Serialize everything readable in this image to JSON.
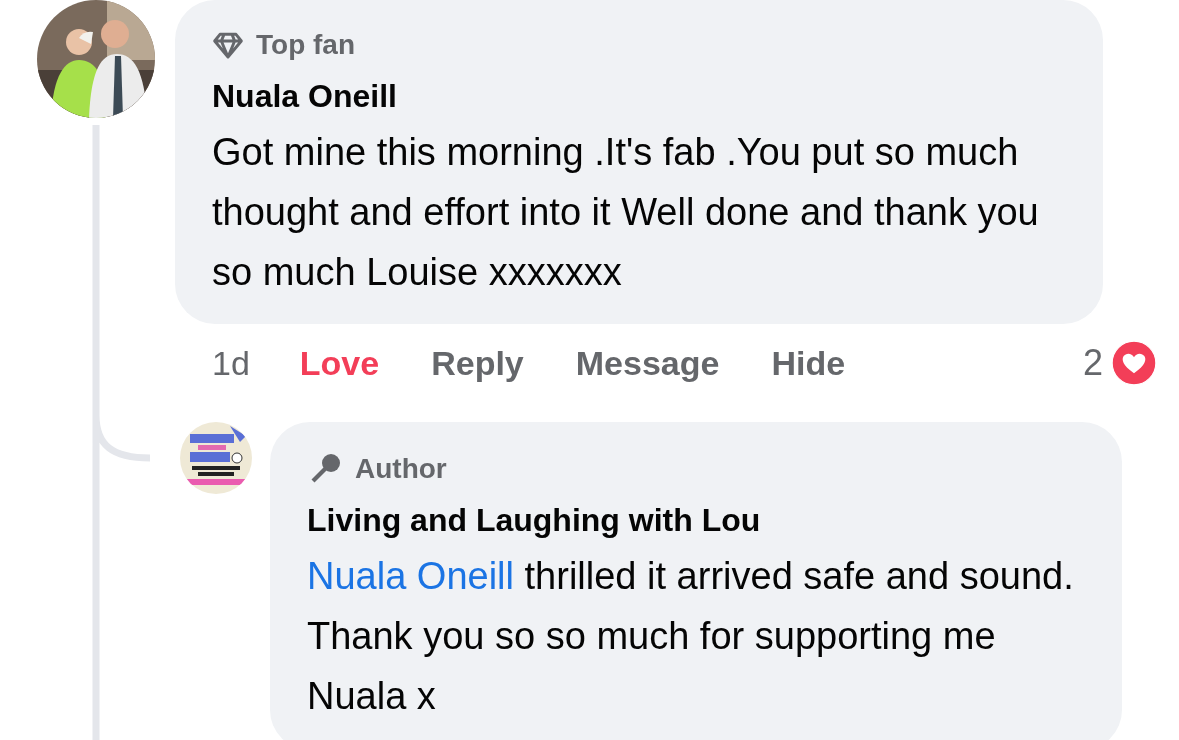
{
  "comment": {
    "badge": "Top fan",
    "author": "Nuala Oneill",
    "text": "Got mine this morning .It's fab .You put so much thought and effort into it Well done and thank you so much Louise xxxxxxx"
  },
  "actions": {
    "time": "1d",
    "items": [
      {
        "label": "Love",
        "selected": true
      },
      {
        "label": "Reply",
        "selected": false
      },
      {
        "label": "Message",
        "selected": false
      },
      {
        "label": "Hide",
        "selected": false
      }
    ],
    "reaction_count": "2"
  },
  "reply": {
    "badge": "Author",
    "author": "Living and Laughing with Lou",
    "mention": "Nuala Oneill",
    "text": " thrilled it arrived safe and sound. Thank you so so much for supporting me Nuala x"
  }
}
